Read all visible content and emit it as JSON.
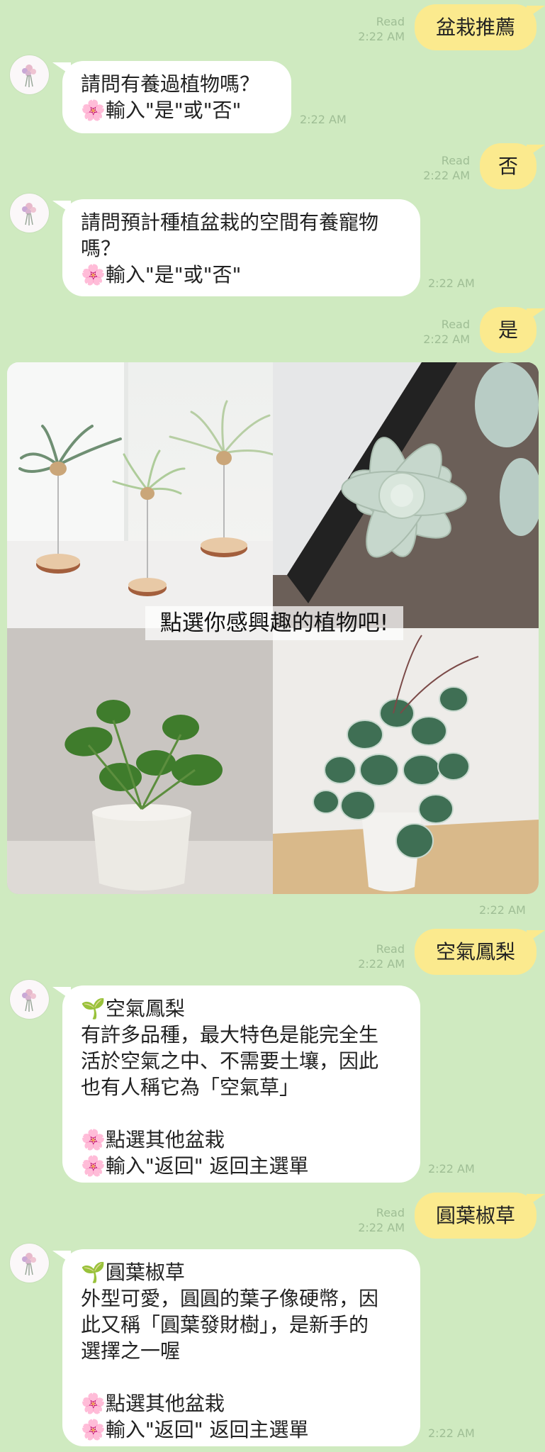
{
  "messages": {
    "m1_out": {
      "text": "盆栽推薦",
      "read": "Read",
      "time": "2:22 AM"
    },
    "m2_in": {
      "lines": [
        "請問有養過植物嗎？",
        "🌸輸入\"是\"或\"否\""
      ],
      "time": "2:22 AM"
    },
    "m3_out": {
      "text": "否",
      "read": "Read",
      "time": "2:22 AM"
    },
    "m4_in": {
      "lines": [
        "請問預計種植盆栽的空間有養寵物",
        "嗎？",
        "🌸輸入\"是\"或\"否\""
      ],
      "time": "2:22 AM"
    },
    "m5_out": {
      "text": "是",
      "read": "Read",
      "time": "2:22 AM"
    },
    "imagemap": {
      "overlay_text": "點選你感興趣的植物吧!",
      "time": "2:22 AM"
    },
    "m6_out": {
      "text": "空氣鳳梨",
      "read": "Read",
      "time": "2:22 AM"
    },
    "m7_in": {
      "lines": [
        "🌱空氣鳳梨",
        "有許多品種，最大特色是能完全生",
        "活於空氣之中、不需要土壤，因此",
        "也有人稱它為「空氣草」",
        "",
        "🌸點選其他盆栽",
        "🌸輸入\"返回\" 返回主選單"
      ],
      "time": "2:22 AM"
    },
    "m8_out": {
      "text": "圓葉椒草",
      "read": "Read",
      "time": "2:22 AM"
    },
    "m9_in": {
      "lines": [
        "🌱圓葉椒草",
        "外型可愛，圓圓的葉子像硬幣，因",
        "此又稱「圓葉發財樹」，是新手的",
        "選擇之一喔",
        "",
        "🌸點選其他盆栽",
        "🌸輸入\"返回\" 返回主選單"
      ],
      "time": "2:22 AM"
    }
  },
  "colors": {
    "background": "#cfeac0",
    "outgoing": "#fbea8e",
    "incoming": "#ffffff",
    "meta": "#9fbe95"
  },
  "icons": {
    "avatar": "flower-bouquet-avatar-icon"
  }
}
